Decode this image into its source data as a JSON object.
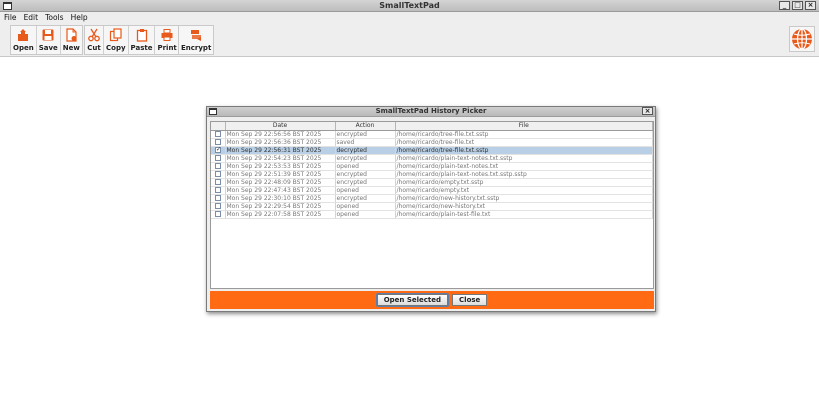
{
  "window": {
    "title": "SmallTextPad"
  },
  "menu": [
    "File",
    "Edit",
    "Tools",
    "Help"
  ],
  "toolbar": {
    "open": "Open",
    "save": "Save",
    "new": "New",
    "cut": "Cut",
    "copy": "Copy",
    "paste": "Paste",
    "print": "Print",
    "encrypt": "Encrypt"
  },
  "icons": {
    "language": "globe-icon"
  },
  "colors": {
    "accent": "#ff6a13",
    "selection": "#b8cfe5"
  },
  "dialog": {
    "title": "SmallTextPad History Picker",
    "columns": [
      "",
      "Date",
      "Action",
      "File"
    ],
    "rows": [
      {
        "checked": false,
        "date": "Mon Sep 29 22:56:56 BST 2025",
        "action": "encrypted",
        "file": "/home/ricardo/tree-file.txt.sstp"
      },
      {
        "checked": false,
        "date": "Mon Sep 29 22:56:36 BST 2025",
        "action": "saved",
        "file": "/home/ricardo/tree-file.txt"
      },
      {
        "checked": true,
        "date": "Mon Sep 29 22:56:31 BST 2025",
        "action": "decrypted",
        "file": "/home/ricardo/tree-file.txt.sstp",
        "selected": true
      },
      {
        "checked": false,
        "date": "Mon Sep 29 22:54:23 BST 2025",
        "action": "encrypted",
        "file": "/home/ricardo/plain-text-notes.txt.sstp"
      },
      {
        "checked": false,
        "date": "Mon Sep 29 22:53:53 BST 2025",
        "action": "opened",
        "file": "/home/ricardo/plain-text-notes.txt"
      },
      {
        "checked": false,
        "date": "Mon Sep 29 22:51:39 BST 2025",
        "action": "encrypted",
        "file": "/home/ricardo/plain-text-notes.txt.sstp.sstp"
      },
      {
        "checked": false,
        "date": "Mon Sep 29 22:48:09 BST 2025",
        "action": "encrypted",
        "file": "/home/ricardo/empty.txt.sstp"
      },
      {
        "checked": false,
        "date": "Mon Sep 29 22:47:43 BST 2025",
        "action": "opened",
        "file": "/home/ricardo/empty.txt"
      },
      {
        "checked": false,
        "date": "Mon Sep 29 22:30:10 BST 2025",
        "action": "encrypted",
        "file": "/home/ricardo/new-history.txt.sstp"
      },
      {
        "checked": false,
        "date": "Mon Sep 29 22:29:54 BST 2025",
        "action": "opened",
        "file": "/home/ricardo/new-history.txt"
      },
      {
        "checked": false,
        "date": "Mon Sep 29 22:07:58 BST 2025",
        "action": "opened",
        "file": "/home/ricardo/plain-test-file.txt"
      }
    ],
    "buttons": {
      "open_selected": "Open Selected",
      "close": "Close"
    }
  }
}
